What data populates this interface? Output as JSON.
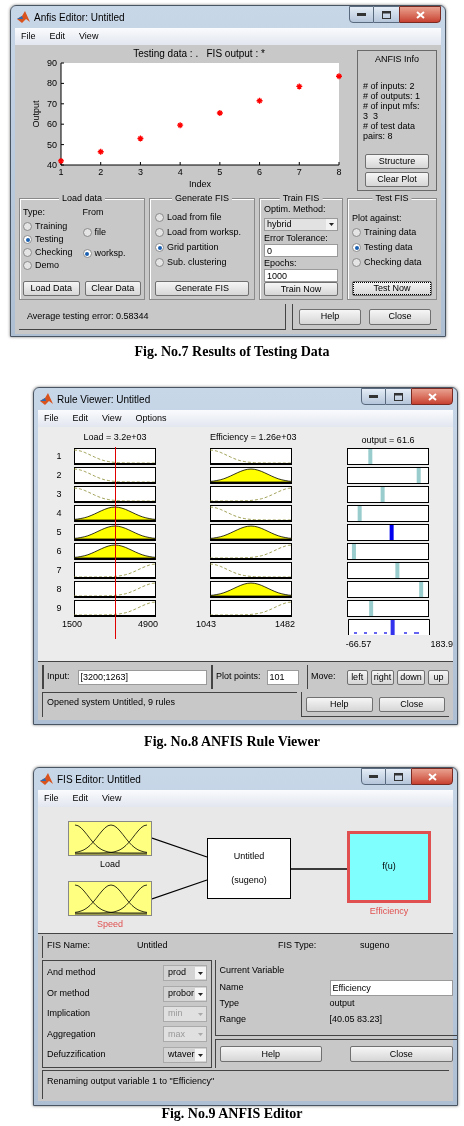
{
  "anfis_editor": {
    "window": {
      "title": "Anfis Editor: Untitled"
    },
    "menu": [
      "File",
      "Edit",
      "View"
    ],
    "plot": {
      "title": "Testing data : .   FIS output : *",
      "chart_data": {
        "type": "scatter",
        "xlabel": "Index",
        "ylabel": "Output",
        "x": [
          1,
          2,
          3,
          4,
          5,
          6,
          7,
          8
        ],
        "series": [
          {
            "color": "#ff0000",
            "values": [
              42,
              46.5,
              53,
              59.5,
              65.5,
              71.5,
              78.5,
              83.5
            ]
          }
        ],
        "xlim": [
          1,
          8
        ],
        "ylim": [
          40,
          90
        ],
        "xticks": [
          1,
          2,
          3,
          4,
          5,
          6,
          7,
          8
        ],
        "yticks": [
          40,
          50,
          60,
          70,
          80,
          90
        ]
      }
    },
    "info": {
      "title": "ANFIS Info",
      "lines": [
        "# of inputs: 2",
        "# of outputs: 1",
        "# of input mfs:",
        "3  3",
        "# of test data",
        "pairs: 8"
      ],
      "buttons": [
        "Structure",
        "Clear Plot"
      ]
    },
    "load_data": {
      "title": "Load data",
      "type_label": "Type:",
      "from_label": "From",
      "types": [
        {
          "label": "Training",
          "selected": false
        },
        {
          "label": "Testing",
          "selected": true
        },
        {
          "label": "Checking",
          "selected": false
        },
        {
          "label": "Demo",
          "selected": false
        }
      ],
      "sources": [
        {
          "label": "file",
          "selected": false
        },
        {
          "label": "worksp.",
          "selected": true
        }
      ],
      "buttons": [
        "Load Data",
        "Clear Data"
      ]
    },
    "generate_fis": {
      "title": "Generate FIS",
      "options": [
        {
          "label": "Load from file",
          "selected": false
        },
        {
          "label": "Load from worksp.",
          "selected": false
        },
        {
          "label": "Grid partition",
          "selected": true
        },
        {
          "label": "Sub. clustering",
          "selected": false
        }
      ],
      "button": "Generate FIS"
    },
    "train_fis": {
      "title": "Train FIS",
      "method_label": "Optim. Method:",
      "method": "hybrid",
      "tolerance_label": "Error Tolerance:",
      "tolerance": "0",
      "epochs_label": "Epochs:",
      "epochs": "1000",
      "button": "Train Now"
    },
    "test_fis": {
      "title": "Test FIS",
      "plot_label": "Plot against:",
      "options": [
        {
          "label": "Training data",
          "selected": false
        },
        {
          "label": "Testing data",
          "selected": true
        },
        {
          "label": "Checking data",
          "selected": false
        }
      ],
      "button": {
        "label": "Test Now",
        "focused": true
      }
    },
    "status": "Average testing error: 0.58344",
    "buttons": [
      "Help",
      "Close"
    ],
    "caption": "Fig. No.7 Results of Testing Data"
  },
  "rule_viewer": {
    "window": {
      "title": "Rule Viewer: Untitled"
    },
    "menu": [
      "File",
      "Edit",
      "View",
      "Options"
    ],
    "columns": [
      {
        "heading": "Load = 3.2e+03",
        "min": "1500",
        "max": "4900"
      },
      {
        "heading": "Efficiency = 1.26e+03",
        "min": "1043",
        "max": "1482"
      },
      {
        "heading": "output = 61.6",
        "min": "-66.57",
        "max": "183.9"
      }
    ],
    "rules": [
      {
        "number": "1",
        "load": {
          "kind": "low",
          "filled": false
        },
        "efficiency": {
          "kind": "low",
          "filled": false
        }
      },
      {
        "number": "2",
        "load": {
          "kind": "low",
          "filled": false
        },
        "efficiency": {
          "kind": "mid",
          "filled": true
        }
      },
      {
        "number": "3",
        "load": {
          "kind": "low",
          "filled": false
        },
        "efficiency": {
          "kind": "high",
          "filled": false
        }
      },
      {
        "number": "4",
        "load": {
          "kind": "mid",
          "filled": true
        },
        "efficiency": {
          "kind": "low",
          "filled": false
        }
      },
      {
        "number": "5",
        "load": {
          "kind": "mid",
          "filled": true
        },
        "efficiency": {
          "kind": "mid",
          "filled": true
        }
      },
      {
        "number": "6",
        "load": {
          "kind": "mid",
          "filled": true
        },
        "efficiency": {
          "kind": "high",
          "filled": false
        }
      },
      {
        "number": "7",
        "load": {
          "kind": "high",
          "filled": false
        },
        "efficiency": {
          "kind": "low",
          "filled": false
        }
      },
      {
        "number": "8",
        "load": {
          "kind": "high",
          "filled": false
        },
        "efficiency": {
          "kind": "mid",
          "filled": true
        }
      },
      {
        "number": "9",
        "load": {
          "kind": "high",
          "filled": false
        },
        "efficiency": {
          "kind": "high",
          "filled": false
        }
      }
    ],
    "input_label": "Input:",
    "input": "[3200;1263]",
    "points_label": "Plot points:",
    "points": "101",
    "move_label": "Move:",
    "move_buttons": [
      "left",
      "right",
      "down",
      "up"
    ],
    "status": "Opened system Untitled, 9 rules",
    "buttons": [
      "Help",
      "Close"
    ],
    "caption": "Fig. No.8 ANFIS Rule Viewer"
  },
  "fis_editor": {
    "window": {
      "title": "FIS Editor: Untitled"
    },
    "menu": [
      "File",
      "Edit",
      "View"
    ],
    "inputs": [
      {
        "label": "Load",
        "highlighted": false
      },
      {
        "label": "Speed",
        "highlighted": true
      }
    ],
    "system": {
      "name": "Untitled",
      "type": "(sugeno)"
    },
    "output": {
      "label": "f(u)",
      "name": "Efficiency",
      "selected": true
    },
    "fis_name_label": "FIS Name:",
    "fis_name": "Untitled",
    "fis_type_label": "FIS Type:",
    "fis_type": "sugeno",
    "methods": [
      {
        "label": "And method",
        "value": "prod",
        "disabled": false
      },
      {
        "label": "Or method",
        "value": "probor",
        "disabled": false
      },
      {
        "label": "Implication",
        "value": "min",
        "disabled": true
      },
      {
        "label": "Aggregation",
        "value": "max",
        "disabled": true
      },
      {
        "label": "Defuzzification",
        "value": "wtaver",
        "disabled": false
      }
    ],
    "current_variable": {
      "title": "Current Variable",
      "name_label": "Name",
      "name": "Efficiency",
      "type_label": "Type",
      "type": "output",
      "range_label": "Range",
      "range": "[40.05 83.23]"
    },
    "buttons": [
      "Help",
      "Close"
    ],
    "status": "Renaming output variable 1 to \"Efficiency\"",
    "caption": "Fig. No.9 ANFIS Editor"
  }
}
